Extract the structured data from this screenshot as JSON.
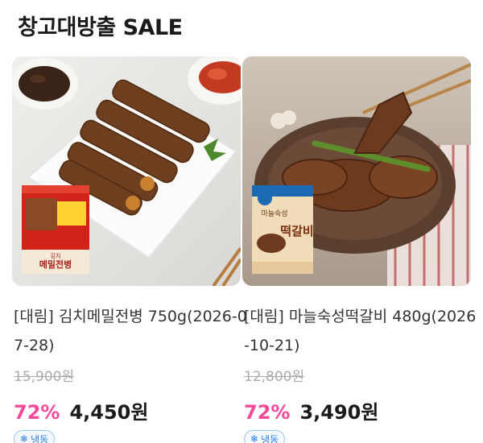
{
  "section": {
    "title": "창고대방출 SALE"
  },
  "products": [
    {
      "name": "[대림] 김치메밀전병 750g(2026-07-28)",
      "original_price": "15,900원",
      "discount": "72%",
      "sale_price": "4,450원",
      "badge": "냉동",
      "badge_icon": "snowflake-icon",
      "package_text": "김치 메밀전병"
    },
    {
      "name": "[대림] 마늘숙성떡갈비 480g(2026-10-21)",
      "original_price": "12,800원",
      "discount": "72%",
      "sale_price": "3,490원",
      "badge": "냉동",
      "badge_icon": "snowflake-icon",
      "package_text_top": "마늘숙성",
      "package_text_main": "떡갈비"
    }
  ],
  "colors": {
    "discount": "#f5499c",
    "badge": "#2a7de1"
  }
}
